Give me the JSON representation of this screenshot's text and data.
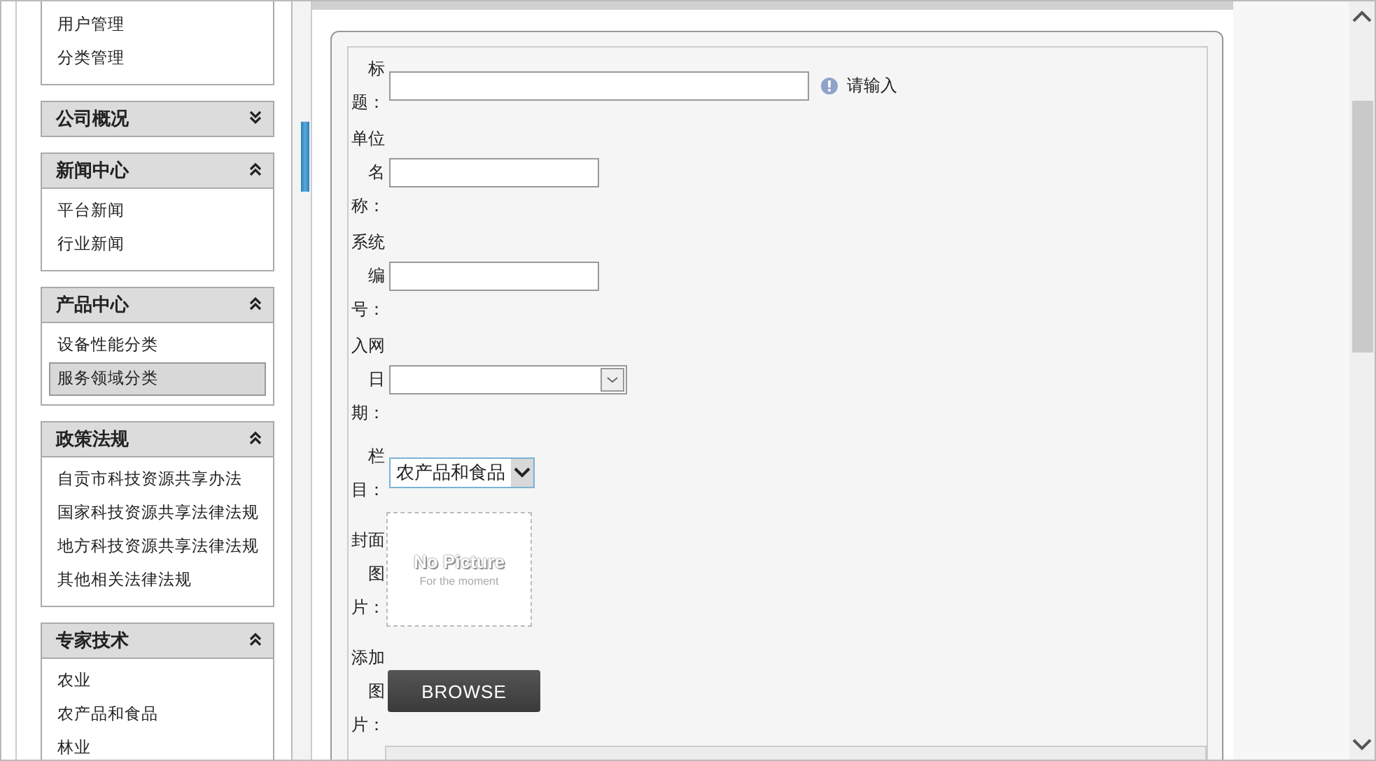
{
  "sidebar": {
    "panels": [
      {
        "items": [
          {
            "label": "用户管理",
            "selected": false
          },
          {
            "label": "分类管理",
            "selected": false
          }
        ]
      },
      {
        "title": "公司概况",
        "expanded": false
      },
      {
        "title": "新闻中心",
        "expanded": true,
        "items": [
          {
            "label": "平台新闻",
            "selected": false
          },
          {
            "label": "行业新闻",
            "selected": false
          }
        ]
      },
      {
        "title": "产品中心",
        "expanded": true,
        "items": [
          {
            "label": "设备性能分类",
            "selected": false
          },
          {
            "label": "服务领域分类",
            "selected": true
          }
        ]
      },
      {
        "title": "政策法规",
        "expanded": true,
        "items": [
          {
            "label": "自贡市科技资源共享办法",
            "selected": false
          },
          {
            "label": "国家科技资源共享法律法规",
            "selected": false
          },
          {
            "label": "地方科技资源共享法律法规",
            "selected": false
          },
          {
            "label": "其他相关法律法规",
            "selected": false
          }
        ]
      },
      {
        "title": "专家技术",
        "expanded": true,
        "items": [
          {
            "label": "农业",
            "selected": false
          },
          {
            "label": "农产品和食品",
            "selected": false
          },
          {
            "label": "林业",
            "selected": false
          }
        ]
      }
    ]
  },
  "form": {
    "rows": [
      {
        "kind": "text-hint",
        "label": "标题：",
        "hint": "请输入"
      },
      {
        "kind": "text",
        "label": "单位名称："
      },
      {
        "kind": "text",
        "label": "系统编号："
      },
      {
        "kind": "date",
        "label": "入网日期："
      },
      {
        "kind": "select",
        "label": "栏目：",
        "value": "农产品和食品"
      },
      {
        "kind": "image",
        "label": "封面图片：",
        "placeholder_title": "No Picture",
        "placeholder_subtitle": "For the moment"
      },
      {
        "kind": "upload",
        "label": "添加图片：",
        "button": "BROWSE"
      },
      {
        "kind": "editor"
      }
    ]
  }
}
